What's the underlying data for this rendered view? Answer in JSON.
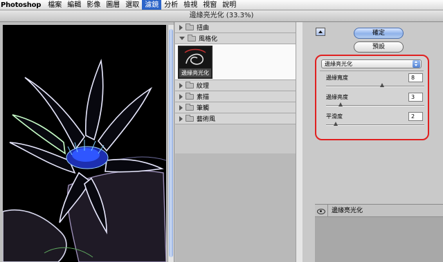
{
  "menubar": {
    "app": "Photoshop",
    "items": [
      "檔案",
      "編輯",
      "影像",
      "圖層",
      "選取",
      "濾鏡",
      "分析",
      "檢視",
      "視窗",
      "說明"
    ],
    "active_index": 5
  },
  "window": {
    "title": "邊緣亮光化 (33.3%)"
  },
  "filter_list": {
    "categories": [
      {
        "label": "扭曲",
        "expanded": false
      },
      {
        "label": "風格化",
        "expanded": true,
        "thumbnail_label": "邊緣亮光化"
      },
      {
        "label": "紋理",
        "expanded": false
      },
      {
        "label": "素描",
        "expanded": false
      },
      {
        "label": "筆觸",
        "expanded": false
      },
      {
        "label": "藝術風",
        "expanded": false
      }
    ]
  },
  "buttons": {
    "ok": "確定",
    "reset": "預設"
  },
  "filter_select": {
    "value": "邊緣亮光化"
  },
  "params": [
    {
      "label": "邊緣寬度",
      "value": "8",
      "slider_fraction": 0.57
    },
    {
      "label": "邊緣亮度",
      "value": "3",
      "slider_fraction": 0.15
    },
    {
      "label": "平滑度",
      "value": "2",
      "slider_fraction": 0.1
    }
  ],
  "layers": {
    "items": [
      {
        "name": "邊緣亮光化"
      }
    ]
  },
  "colors": {
    "menu_highlight": "#2b64c9",
    "annotation_ring": "#e02020",
    "ok_button": "#8fb2ea"
  }
}
